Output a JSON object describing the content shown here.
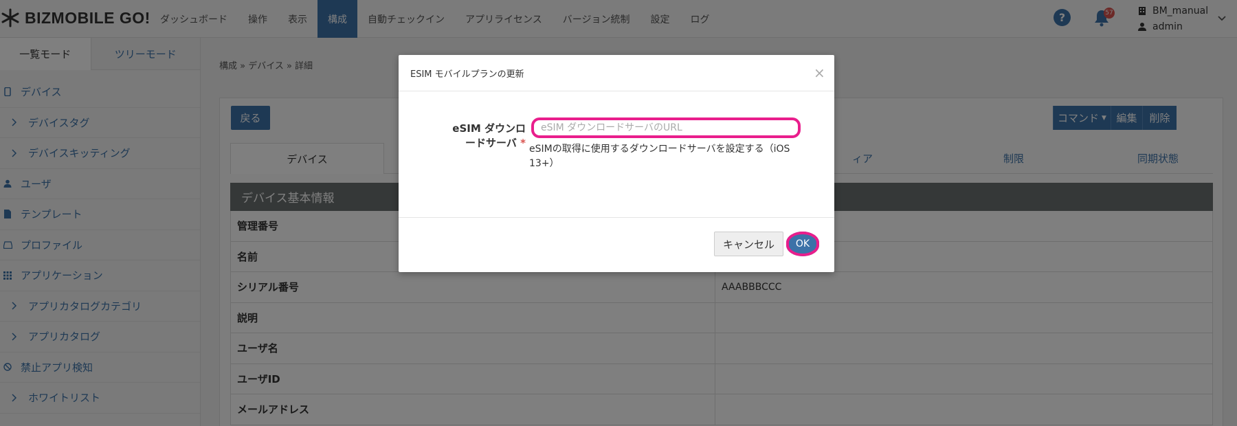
{
  "app": {
    "logo_text": "BIZMOBILE GO!"
  },
  "nav": {
    "items": [
      "ダッシュボード",
      "操作",
      "表示",
      "構成",
      "自動チェックイン",
      "アプリライセンス",
      "バージョン統制",
      "設定",
      "ログ"
    ],
    "active": "構成"
  },
  "header": {
    "help_icon": "?",
    "notification_count": "57",
    "tenant": "BM_manual",
    "user": "admin"
  },
  "sidebar": {
    "mode_tabs": [
      "一覧モード",
      "ツリーモード"
    ],
    "items": [
      {
        "label": "デバイス",
        "icon": "mobile-icon"
      },
      {
        "label": "デバイスタグ",
        "icon": "chevron-right-icon"
      },
      {
        "label": "デバイスキッティング",
        "icon": "chevron-right-icon"
      },
      {
        "label": "ユーザ",
        "icon": "user-icon"
      },
      {
        "label": "テンプレート",
        "icon": "file-icon"
      },
      {
        "label": "プロファイル",
        "icon": "inbox-icon"
      },
      {
        "label": "アプリケーション",
        "icon": "grid-icon"
      },
      {
        "label": "アプリカタログカテゴリ",
        "icon": "chevron-right-icon"
      },
      {
        "label": "アプリカタログ",
        "icon": "chevron-right-icon"
      },
      {
        "label": "禁止アプリ検知",
        "icon": "ban-icon"
      },
      {
        "label": "ホワイトリスト",
        "icon": "chevron-right-icon"
      }
    ]
  },
  "main": {
    "breadcrumb": "構成 » デバイス » 詳細",
    "back_button": "戻る",
    "command_button": "コマンド",
    "edit_button": "編集",
    "delete_button": "削除",
    "tabs": [
      "デバイス",
      "ィア",
      "制限",
      "同期状態"
    ],
    "section_title": "デバイス基本情報",
    "rows": [
      {
        "key": "管理番号",
        "value": ""
      },
      {
        "key": "名前",
        "value": ""
      },
      {
        "key": "シリアル番号",
        "value": "AAABBBCCC"
      },
      {
        "key": "説明",
        "value": ""
      },
      {
        "key": "ユーザ名",
        "value": ""
      },
      {
        "key": "ユーザID",
        "value": ""
      },
      {
        "key": "メールアドレス",
        "value": ""
      }
    ]
  },
  "modal": {
    "title": "ESIM モバイルプランの更新",
    "close": "×",
    "field_label_line1": "eSIM ダウンロ",
    "field_label_line2": "ードサーバ",
    "required_mark": "*",
    "input_placeholder": "eSIM ダウンロードサーバのURL",
    "input_value": "",
    "help_text": "eSIMの取得に使用するダウンロードサーバを設定する（iOS 13+）",
    "cancel_button": "キャンセル",
    "ok_button": "OK"
  },
  "colors": {
    "primary": "#3c72a8",
    "highlight": "#e91e8c",
    "badge": "#d9534f",
    "section_header": "#6b7070"
  }
}
